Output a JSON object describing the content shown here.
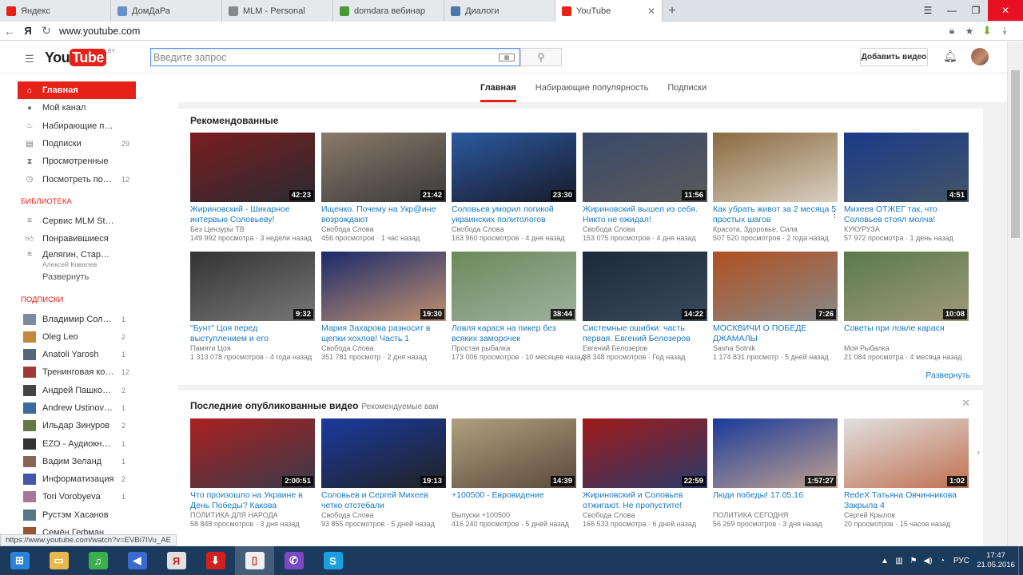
{
  "browser": {
    "tabs": [
      {
        "label": "Яндекс",
        "icon": "yandex-icon",
        "color": "#e62117"
      },
      {
        "label": "ДомДаРа",
        "icon": "globe-icon",
        "color": "#6b8fc7"
      },
      {
        "label": "MLM - Personal",
        "icon": "page-icon",
        "color": "#888888"
      },
      {
        "label": "domdara вебинар",
        "icon": "leaf-icon",
        "color": "#4a9a3a"
      },
      {
        "label": "Диалоги",
        "icon": "chat-icon",
        "color": "#4a76a8"
      },
      {
        "label": "YouTube",
        "icon": "youtube-icon",
        "color": "#e62117",
        "active": true
      }
    ],
    "new_tab": "+",
    "url": "www.youtube.com",
    "yandex_letter": "Я",
    "status_url": "https://www.youtube.com/watch?v=EVBi7IVu_AE"
  },
  "header": {
    "logo_you": "You",
    "logo_tube": "Tube",
    "logo_region": "BY",
    "search_placeholder": "Введите запрос",
    "upload_label": "Добавить видео"
  },
  "sidebar": {
    "home": {
      "label": "Главная",
      "icon": "home-icon"
    },
    "nav": [
      {
        "label": "Мой канал",
        "icon": "person-icon",
        "count": ""
      },
      {
        "label": "Набирающие популярность",
        "icon": "flame-icon",
        "count": ""
      },
      {
        "label": "Подписки",
        "icon": "subscriptions-icon",
        "count": "29"
      },
      {
        "label": "Просмотренные",
        "icon": "history-icon",
        "count": ""
      },
      {
        "label": "Посмотреть позже",
        "icon": "clock-icon",
        "count": "12"
      }
    ],
    "library_heading": "БИБЛИОТЕКА",
    "library": [
      {
        "label": "Сервис MLM Step Global",
        "icon": "playlist-icon",
        "sub": ""
      },
      {
        "label": "Понравившиеся",
        "icon": "thumbs-up-icon",
        "sub": ""
      },
      {
        "label": "Делягин, Стариков, Хазин",
        "icon": "playlist-icon",
        "sub": "Алексей Ковалев"
      }
    ],
    "expand_label": "Развернуть",
    "subs_heading": "ПОДПИСКИ",
    "subscriptions": [
      {
        "label": "Владимир Соловьёв",
        "count": "1",
        "color": "#7d8aa0"
      },
      {
        "label": "Oleg Leo",
        "count": "2",
        "color": "#c08a3a"
      },
      {
        "label": "Anatoli Yarosh",
        "count": "1",
        "color": "#556677"
      },
      {
        "label": "Тренинговая компания",
        "count": "12",
        "color": "#a03a3a"
      },
      {
        "label": "Андрей Пашковский",
        "count": "2",
        "color": "#444444"
      },
      {
        "label": "Andrew Ustinovich",
        "count": "1",
        "color": "#3a6aa0"
      },
      {
        "label": "Ильдар Зинуров",
        "count": "2",
        "color": "#667744"
      },
      {
        "label": "EZO - Аудиокниги",
        "count": "1",
        "color": "#333333"
      },
      {
        "label": "Вадим Зеланд",
        "count": "1",
        "color": "#886655"
      },
      {
        "label": "Информатизация",
        "count": "2",
        "color": "#4455aa"
      },
      {
        "label": "Tori Vorobyeva",
        "count": "1",
        "color": "#aa7799"
      },
      {
        "label": "Рустэм Хасанов",
        "count": "",
        "color": "#557788"
      },
      {
        "label": "Семён Гефман",
        "count": "",
        "color": "#995533"
      }
    ]
  },
  "main_tabs": [
    {
      "label": "Главная",
      "active": true
    },
    {
      "label": "Набирающие популярность",
      "active": false
    },
    {
      "label": "Подписки",
      "active": false
    }
  ],
  "recommended": {
    "title": "Рекомендованные",
    "expand_label": "Развернуть",
    "videos": [
      {
        "title": "Жириновский - Шикарное интервью Соловьеву!",
        "channel": "Без Цензуры ТВ",
        "views": "149 992 просмотра",
        "age": "3 недели назад",
        "duration": "42:23",
        "thumb": [
          "#7a1e1e",
          "#2a2a33"
        ]
      },
      {
        "title": "Ищенко. Почему на Укр@ине возрождают",
        "channel": "Свобода Слова",
        "views": "456 просмотров",
        "age": "1 час назад",
        "duration": "21:42",
        "thumb": [
          "#8a7a6a",
          "#3a3a3a"
        ]
      },
      {
        "title": "Соловьев уморил логикой украинских политологов",
        "channel": "Свобода Слова",
        "views": "163 960 просмотров",
        "age": "4 дня назад",
        "duration": "23:30",
        "thumb": [
          "#2a5aa0",
          "#1a1a2a"
        ]
      },
      {
        "title": "Жириновский вышел из себя. Никто не ожидал!",
        "channel": "Свобода Слова",
        "views": "153 075 просмотров",
        "age": "4 дня назад",
        "duration": "11:56",
        "thumb": [
          "#3a4a6a",
          "#5a5a5a"
        ]
      },
      {
        "title": "Как убрать живот за 2 месяца 5 простых шагов",
        "channel": "Красота, Здоровье, Сила",
        "views": "507 520 просмотров",
        "age": "2 года назад",
        "duration": "",
        "thumb": [
          "#8a6a40",
          "#d8cfc0"
        ]
      },
      {
        "title": "Михеев ОТЖЕГ так, что Соловьев стоял молча!",
        "channel": "КУКУРУЗА",
        "views": "57 972 просмотра",
        "age": "1 день назад",
        "duration": "4:51",
        "thumb": [
          "#1a3a8a",
          "#445566"
        ]
      },
      {
        "title": "\"Бунт\" Цоя перед выступлением и его",
        "channel": "Памяти Цоя",
        "views": "1 313 078 просмотров",
        "age": "4 года назад",
        "duration": "9:32",
        "thumb": [
          "#333333",
          "#777777"
        ]
      },
      {
        "title": "Мария Захарова разносит в щепки хохлов! Часть 1",
        "channel": "Свобода Слова",
        "views": "351 781 просмотр",
        "age": "2 дня назад",
        "duration": "19:30",
        "thumb": [
          "#1a2a6a",
          "#c09070"
        ]
      },
      {
        "title": "Ловля карася на пикер без всяких заморочек",
        "channel": "Простая рыбалка",
        "views": "173 006 просмотров",
        "age": "10 месяцев назад",
        "duration": "38:44",
        "thumb": [
          "#6a8a5a",
          "#a0b0a0"
        ]
      },
      {
        "title": "Системные ошибки: часть первая. Евгений Белозеров",
        "channel": "Евгений Белозеров",
        "views": "38 348 просмотров",
        "age": "Год назад",
        "duration": "14:22",
        "thumb": [
          "#1a2a3a",
          "#3a4a5a"
        ]
      },
      {
        "title": "МОСКВИЧИ О ПОБЕДЕ ДЖАМАЛЫ",
        "channel": "Sasha Sotnik",
        "views": "1 174 831 просмотр",
        "age": "5 дней назад",
        "duration": "7:26",
        "thumb": [
          "#b05020",
          "#888888"
        ]
      },
      {
        "title": "Советы при ловле карася",
        "channel": "Моя Рыбалка",
        "views": "21 084 просмотра",
        "age": "4 месяца назад",
        "duration": "10:08",
        "thumb": [
          "#5a7a4a",
          "#a09a7a"
        ]
      }
    ]
  },
  "latest": {
    "title": "Последние опубликованные видео",
    "subtitle": "Рекомендуемые вам",
    "videos": [
      {
        "title": "Что произошло на Украине в День Победы? Какова",
        "channel": "ПОЛИТИКА ДЛЯ НАРОДА",
        "views": "58 848 просмотров",
        "age": "3 дня назад",
        "duration": "2:00:51",
        "thumb": [
          "#aa2020",
          "#3a3a4a"
        ]
      },
      {
        "title": "Соловьев и Сергей Михеев четко отстебали",
        "channel": "Свобода Слова",
        "views": "93 855 просмотров",
        "age": "5 дней назад",
        "duration": "19:13",
        "thumb": [
          "#1a3aa0",
          "#222222"
        ]
      },
      {
        "title": "+100500 - Евровидение",
        "channel": "Выпуски +100500",
        "views": "416 240 просмотров",
        "age": "5 дней назад",
        "duration": "14:39",
        "thumb": [
          "#b0a080",
          "#5a4a3a"
        ]
      },
      {
        "title": "Жириновский и Соловьев отжигают. Не пропустите!",
        "channel": "Свобода Слова",
        "views": "166 533 просмотра",
        "age": "6 дней назад",
        "duration": "22:59",
        "thumb": [
          "#a01a1a",
          "#2a3a6a"
        ]
      },
      {
        "title": "Люди победы! 17.05.16",
        "channel": "ПОЛИТИКА СЕГОДНЯ",
        "views": "56 269 просмотров",
        "age": "3 дня назад",
        "duration": "1:57:27",
        "thumb": [
          "#1a3a9a",
          "#c0a090"
        ]
      },
      {
        "title": "RedeX Татьяна Овчинникова Закрыла 4",
        "channel": "Сергей Крылов",
        "views": "20 просмотров",
        "age": "15 часов назад",
        "duration": "1:02",
        "thumb": [
          "#e0e0e0",
          "#c07050"
        ]
      }
    ]
  },
  "taskbar": {
    "apps": [
      {
        "name": "start-button",
        "icon": "windows-icon",
        "color": "#2a82da",
        "glyph": "⊞"
      },
      {
        "name": "explorer",
        "icon": "folder-icon",
        "color": "#e8b84a",
        "glyph": "▭"
      },
      {
        "name": "music",
        "icon": "music-icon",
        "color": "#3ab04a",
        "glyph": "♫"
      },
      {
        "name": "audio",
        "icon": "speaker-icon",
        "color": "#3a6ad0",
        "glyph": "◀"
      },
      {
        "name": "yandex-browser",
        "icon": "yandex-icon",
        "color": "#e0e0e0",
        "glyph": "Я"
      },
      {
        "name": "downloader",
        "icon": "download-icon",
        "color": "#d02020",
        "glyph": "⬇"
      },
      {
        "name": "document",
        "icon": "document-icon",
        "color": "#f0f0f0",
        "glyph": "▯"
      },
      {
        "name": "viber",
        "icon": "viber-icon",
        "color": "#7a4ac0",
        "glyph": "✆"
      },
      {
        "name": "skype",
        "icon": "skype-icon",
        "color": "#1aa0e0",
        "glyph": "S"
      }
    ],
    "language": "РУС",
    "time": "17:47",
    "date": "21.05.2016"
  }
}
